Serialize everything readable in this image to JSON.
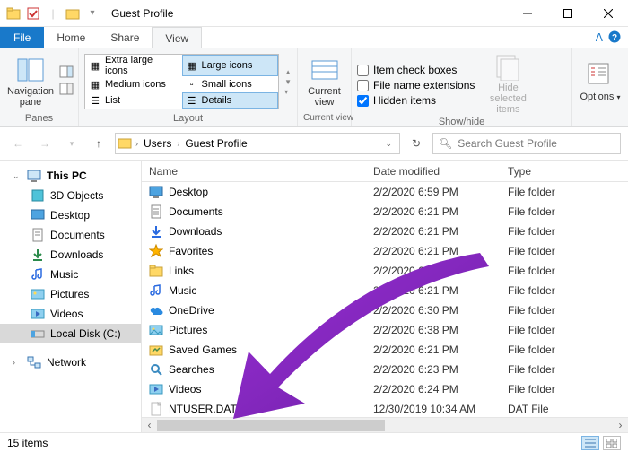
{
  "window": {
    "title": "Guest Profile"
  },
  "tabs": {
    "file": "File",
    "home": "Home",
    "share": "Share",
    "view": "View"
  },
  "ribbon": {
    "panes_group": "Panes",
    "nav_pane": "Navigation\npane",
    "layout_group": "Layout",
    "view_opts": {
      "xl": "Extra large icons",
      "lg": "Large icons",
      "md": "Medium icons",
      "sm": "Small icons",
      "list": "List",
      "details": "Details"
    },
    "current_view_group": "Current view",
    "current_view": "Current\nview",
    "showhide_group": "Show/hide",
    "check_item": "Item check boxes",
    "check_ext": "File name extensions",
    "check_hidden": "Hidden items",
    "hide_selected": "Hide selected\nitems",
    "options": "Options"
  },
  "address": {
    "segs": [
      "Users",
      "Guest Profile"
    ]
  },
  "search": {
    "placeholder": "Search Guest Profile"
  },
  "nav": {
    "this_pc": "This PC",
    "items": [
      "3D Objects",
      "Desktop",
      "Documents",
      "Downloads",
      "Music",
      "Pictures",
      "Videos",
      "Local Disk (C:)"
    ],
    "network": "Network"
  },
  "columns": {
    "name": "Name",
    "date": "Date modified",
    "type": "Type"
  },
  "files": [
    {
      "icon": "desktop",
      "name": "Desktop",
      "date": "2/2/2020 6:59 PM",
      "type": "File folder"
    },
    {
      "icon": "doc",
      "name": "Documents",
      "date": "2/2/2020 6:21 PM",
      "type": "File folder"
    },
    {
      "icon": "down",
      "name": "Downloads",
      "date": "2/2/2020 6:21 PM",
      "type": "File folder"
    },
    {
      "icon": "star",
      "name": "Favorites",
      "date": "2/2/2020 6:21 PM",
      "type": "File folder"
    },
    {
      "icon": "folder",
      "name": "Links",
      "date": "2/2/2020 6:21 PM",
      "type": "File folder"
    },
    {
      "icon": "music",
      "name": "Music",
      "date": "2/2/2020 6:21 PM",
      "type": "File folder"
    },
    {
      "icon": "cloud",
      "name": "OneDrive",
      "date": "2/2/2020 6:30 PM",
      "type": "File folder"
    },
    {
      "icon": "pic",
      "name": "Pictures",
      "date": "2/2/2020 6:38 PM",
      "type": "File folder"
    },
    {
      "icon": "save",
      "name": "Saved Games",
      "date": "2/2/2020 6:21 PM",
      "type": "File folder"
    },
    {
      "icon": "search",
      "name": "Searches",
      "date": "2/2/2020 6:23 PM",
      "type": "File folder"
    },
    {
      "icon": "video",
      "name": "Videos",
      "date": "2/2/2020 6:24 PM",
      "type": "File folder"
    },
    {
      "icon": "file",
      "name": "NTUSER.DAT",
      "date": "12/30/2019 10:34 AM",
      "type": "DAT File"
    }
  ],
  "status": {
    "count": "15 items"
  }
}
